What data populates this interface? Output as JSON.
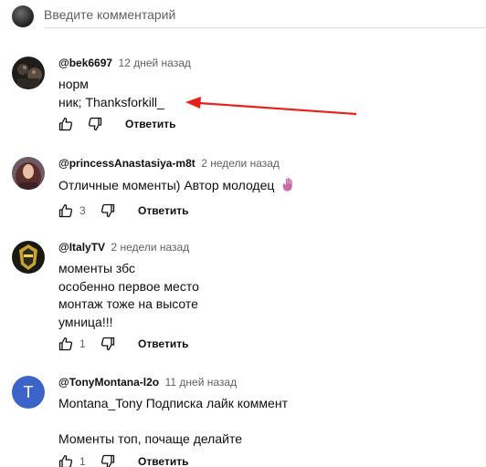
{
  "input": {
    "placeholder": "Введите комментарий"
  },
  "reply_label": "Ответить",
  "comments": [
    {
      "author": "@bek6697",
      "time": "12 дней назад",
      "lines": [
        "норм",
        "ник; Thanksforkill_"
      ],
      "likes": ""
    },
    {
      "author": "@princessAnastasiya-m8t",
      "time": "2 недели назад",
      "lines": [
        "Отличные моменты) Автор молодец"
      ],
      "likes": "3"
    },
    {
      "author": "@ItalyTV",
      "time": "2 недели назад",
      "lines": [
        "моменты збс",
        "особенно первое место",
        "монтаж тоже на высоте",
        "умница!!!"
      ],
      "likes": "1"
    },
    {
      "author": "@TonyMontana-l2o",
      "time": "11 дней назад",
      "avatar_letter": "T",
      "lines": [
        "Montana_Tony Подписка лайк коммент",
        "",
        "Моменты топ, почаще делайте"
      ],
      "likes": "1"
    }
  ],
  "colors": {
    "annotation_arrow": "#e8211b",
    "letter_avatar": "#3c64c8"
  }
}
